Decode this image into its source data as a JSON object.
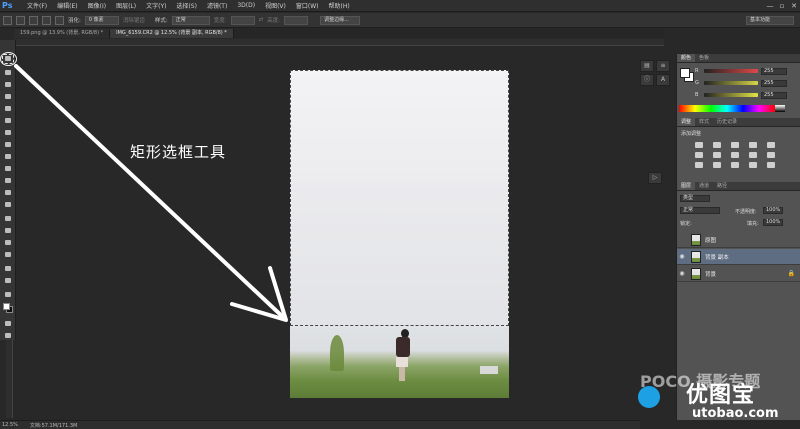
{
  "app": {
    "logo": "Ps"
  },
  "menu": [
    "文件(F)",
    "编辑(E)",
    "图像(I)",
    "图层(L)",
    "文字(Y)",
    "选择(S)",
    "滤镜(T)",
    "3D(D)",
    "视图(V)",
    "窗口(W)",
    "帮助(H)"
  ],
  "window_controls": {
    "minimize": "—",
    "restore": "▫",
    "close": "✕"
  },
  "options_bar": {
    "feather_label": "羽化:",
    "feather_value": "0 像素",
    "antialias_label": "消除锯齿",
    "style_label": "样式:",
    "style_value": "正常",
    "width_label": "宽度:",
    "height_label": "高度:",
    "refine_button": "调整边缘...",
    "workspace": "基本功能"
  },
  "tabs": [
    {
      "label": "159.png @ 13.9% (背景, RGB/8) *",
      "active": false
    },
    {
      "label": "IMG_6159.CR2 @ 12.5% (背景 副本, RGB/8) *",
      "active": true
    }
  ],
  "annotation": {
    "text": "矩形选框工具"
  },
  "panels": {
    "color_tabs": [
      "颜色",
      "色板"
    ],
    "color_rows": [
      {
        "channel": "R",
        "value": "255",
        "color": "#e04848"
      },
      {
        "channel": "G",
        "value": "255",
        "color": "#48c048"
      },
      {
        "channel": "B",
        "value": "255",
        "color": "#4868e0"
      }
    ],
    "adjust_tabs": [
      "调整",
      "样式",
      "历史记录"
    ],
    "adjust_title": "添加调整",
    "layer_tabs": [
      "图层",
      "通道",
      "路径"
    ],
    "layer_kind": "类型",
    "blend_mode": "正常",
    "opacity_label": "不透明度:",
    "opacity_value": "100%",
    "lock_label": "锁定:",
    "fill_label": "填充:",
    "fill_value": "100%",
    "layers": [
      {
        "name": "原图",
        "visible": false,
        "active": false,
        "locked": false
      },
      {
        "name": "背景 副本",
        "visible": true,
        "active": true,
        "locked": false
      },
      {
        "name": "背景",
        "visible": true,
        "active": false,
        "locked": true
      }
    ]
  },
  "status": {
    "zoom": "12.5%",
    "doc": "文档:57.1M/171.3M"
  },
  "watermark": {
    "poco": "POCO 摄影专题",
    "brand": "优图宝",
    "url": "utobao.com"
  }
}
